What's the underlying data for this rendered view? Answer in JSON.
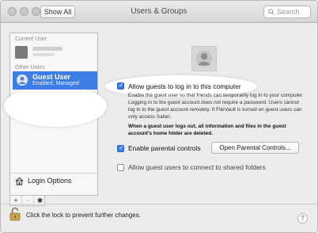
{
  "window": {
    "title": "Users & Groups",
    "show_all_label": "Show All",
    "search_placeholder": "Search"
  },
  "sidebar": {
    "current_user_header": "Current User",
    "other_users_header": "Other Users",
    "guest_user": {
      "name": "Guest User",
      "status": "Enabled, Managed"
    },
    "login_options_label": "Login Options",
    "add_label": "+",
    "remove_label": "−",
    "action_label": "✱"
  },
  "main": {
    "allow_guests_label": "Allow guests to log in to this computer",
    "allow_guests_checked": true,
    "description": "Enable the guest user so that friends can temporarily log in to your computer. Logging in to the guest account does not require a password. Users cannot log in to the guest account remotely. If FileVault is turned on guest users can only access Safari.",
    "warning": "When a guest user logs out, all information and files in the guest account's home folder are deleted.",
    "parental_controls_label": "Enable parental controls",
    "parental_controls_checked": true,
    "open_parental_button": "Open Parental Controls...",
    "shared_folders_label": "Allow guest users to connect to shared folders",
    "shared_folders_checked": false
  },
  "footer": {
    "lock_text": "Click the lock to prevent further changes.",
    "help_label": "?"
  },
  "colors": {
    "selection": "#3c7ee6",
    "checkbox_on": "#3a7ee9"
  }
}
